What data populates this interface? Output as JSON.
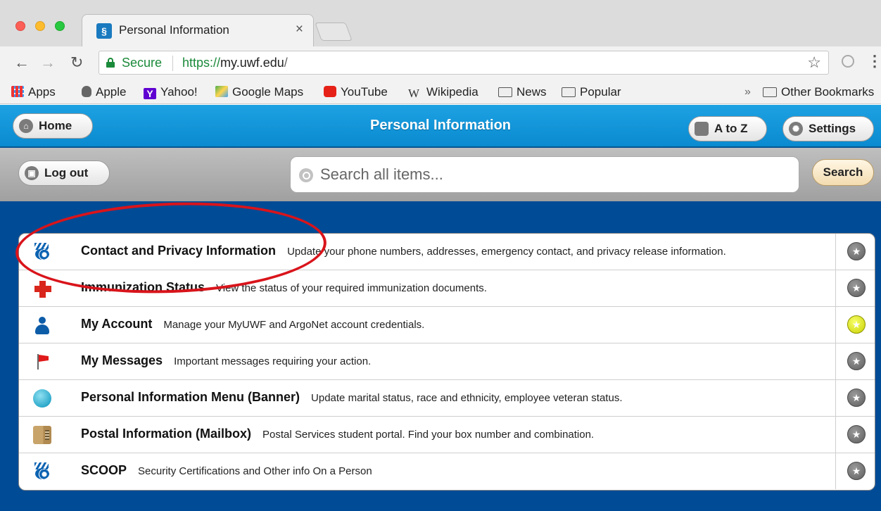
{
  "browser": {
    "tab_title": "Personal Information",
    "tab_close": "×",
    "secure_label": "Secure",
    "url_scheme": "https://",
    "url_host": "my.uwf.edu",
    "url_path": "/",
    "bookmarks": [
      {
        "label": "Apps",
        "icon": "apps-icon"
      },
      {
        "label": "Apple",
        "icon": "apple-icon"
      },
      {
        "label": "Yahoo!",
        "icon": "yahoo-icon"
      },
      {
        "label": "Google Maps",
        "icon": "google-maps-icon"
      },
      {
        "label": "YouTube",
        "icon": "youtube-icon"
      },
      {
        "label": "Wikipedia",
        "icon": "wikipedia-icon"
      },
      {
        "label": "News",
        "icon": "folder-icon"
      },
      {
        "label": "Popular",
        "icon": "folder-icon"
      },
      {
        "label": "Other Bookmarks",
        "icon": "folder-icon"
      }
    ],
    "more_bookmarks": "»"
  },
  "header": {
    "title": "Personal Information",
    "home_label": "Home",
    "atoz_label": "A to Z",
    "settings_label": "Settings"
  },
  "subheader": {
    "logout_label": "Log out",
    "search_placeholder": "Search all items...",
    "search_button": "Search"
  },
  "items": [
    {
      "title": "Contact and Privacy Information",
      "desc": "Update your phone numbers, addresses, emergency contact, and privacy release information.",
      "icon": "shell-logo-icon",
      "favorite": false
    },
    {
      "title": "Immunization Status",
      "desc": "View the status of your required immunization documents.",
      "icon": "red-cross-icon",
      "favorite": false
    },
    {
      "title": "My Account",
      "desc": "Manage your MyUWF and ArgoNet account credentials.",
      "icon": "user-icon",
      "favorite": true
    },
    {
      "title": "My Messages",
      "desc": "Important messages requiring your action.",
      "icon": "flag-icon",
      "favorite": false
    },
    {
      "title": "Personal Information Menu (Banner)",
      "desc": "Update marital status, race and ethnicity, employee veteran status.",
      "icon": "globe-icon",
      "favorite": false
    },
    {
      "title": "Postal Information (Mailbox)",
      "desc": "Postal Services student portal. Find your box number and combination.",
      "icon": "mailbox-icon",
      "favorite": false
    },
    {
      "title": "SCOOP",
      "desc": "Security Certifications and Other info On a Person",
      "icon": "shell-logo-icon",
      "favorite": false
    }
  ],
  "colors": {
    "header_blue": "#1ea2e3",
    "page_background": "#004b96",
    "annotation_red": "#d9141b",
    "favorite_on": "#c9d100"
  }
}
